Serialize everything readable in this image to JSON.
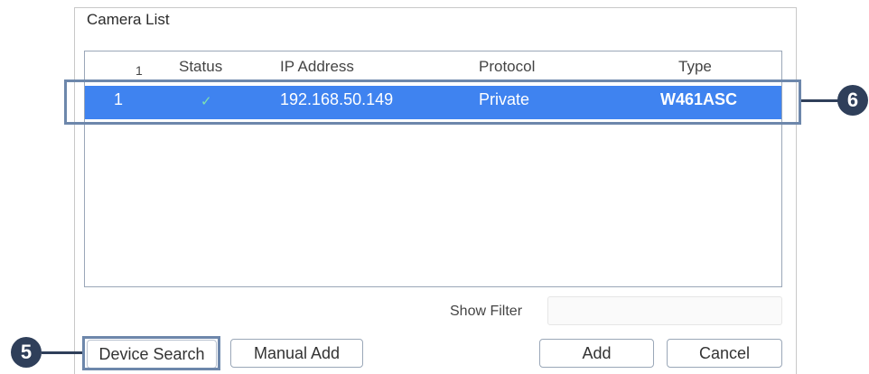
{
  "dialog": {
    "title": "Camera List"
  },
  "table": {
    "columns": {
      "index": "1",
      "status": "Status",
      "ip": "IP Address",
      "protocol": "Protocol",
      "type": "Type"
    },
    "rows": [
      {
        "index": "1",
        "status": "✓",
        "ip": "192.168.50.149",
        "protocol": "Private",
        "type": "W461ASC",
        "selected": true
      }
    ]
  },
  "filter": {
    "label": "Show Filter",
    "value": ""
  },
  "buttons": {
    "device_search": "Device Search",
    "manual_add": "Manual Add",
    "add": "Add",
    "cancel": "Cancel"
  },
  "callouts": {
    "row": "6",
    "device_search": "5"
  },
  "colors": {
    "selection": "#3f83f0",
    "callout": "#2f3f5a",
    "callout_border": "#6d87ab",
    "status_ok": "#7fe3b0"
  }
}
